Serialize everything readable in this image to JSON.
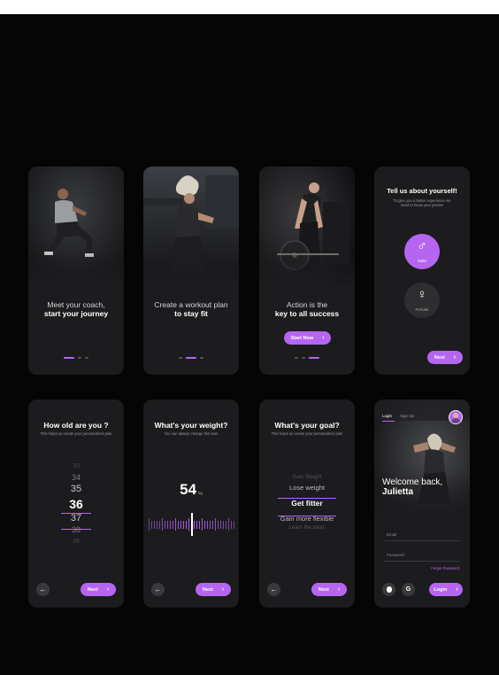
{
  "onboarding": [
    {
      "line1": "Meet your coach,",
      "line2": "start your journey"
    },
    {
      "line1": "Create a workout plan",
      "line2": "to stay fit"
    },
    {
      "line1": "Action is the",
      "line2": "key to all success",
      "button": "Start Now"
    }
  ],
  "gender": {
    "title": "Tell us about yourself!",
    "subtitle": "To give you a better experience we need to know your gender",
    "male": "Male",
    "female": "Female",
    "next": "Next"
  },
  "age": {
    "title": "How old are you ?",
    "subtitle": "This helps us create your personalized plan",
    "values": [
      "33",
      "34",
      "35",
      "36",
      "37",
      "38",
      "39"
    ],
    "selected_index": 3,
    "next": "Next"
  },
  "weight": {
    "title": "What's your weight?",
    "subtitle": "You can always change this later",
    "value": "54",
    "unit": "kg",
    "next": "Next"
  },
  "goal": {
    "title": "What's your goal?",
    "subtitle": "This helps us create your personalized plan",
    "options": [
      "Gain Weight",
      "Lose weight",
      "Get fitter",
      "Gain more flexible",
      "Learn the basic"
    ],
    "selected_index": 2,
    "next": "Next"
  },
  "login": {
    "tab_login": "Login",
    "tab_signup": "Sign Up",
    "welcome": "Welcome back,",
    "name": "Julietta",
    "email_label": "Email",
    "password_label": "Password",
    "forgot": "Forgot Password",
    "button": "Login"
  },
  "colors": {
    "accent": "#b565f2",
    "card": "#1c1c1e",
    "background": "#050505"
  }
}
